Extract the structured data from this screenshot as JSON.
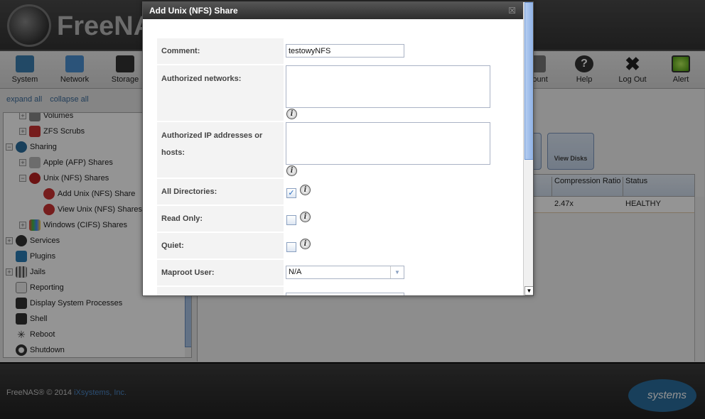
{
  "header": {
    "brand": "FreeNAS"
  },
  "toolbar": {
    "items": [
      {
        "label": "System",
        "icon": "system-icon"
      },
      {
        "label": "Network",
        "icon": "network-icon"
      },
      {
        "label": "Storage",
        "icon": "storage-icon"
      },
      {
        "label": "Account",
        "visible": "ount",
        "icon": "account-icon"
      },
      {
        "label": "Help",
        "icon": "help-icon"
      },
      {
        "label": "Log Out",
        "icon": "logout-icon"
      },
      {
        "label": "Alert",
        "icon": "alert-icon"
      }
    ]
  },
  "tree_links": {
    "expand": "expand all",
    "collapse": "collapse all"
  },
  "tree": [
    {
      "label": "Volumes"
    },
    {
      "label": "ZFS Scrubs"
    },
    {
      "label": "Sharing"
    },
    {
      "label": "Apple (AFP) Shares"
    },
    {
      "label": "Unix (NFS) Shares"
    },
    {
      "label": "Add Unix (NFS) Share"
    },
    {
      "label": "View Unix (NFS) Shares"
    },
    {
      "label": "Windows (CIFS) Shares"
    },
    {
      "label": "Services"
    },
    {
      "label": "Plugins"
    },
    {
      "label": "Jails"
    },
    {
      "label": "Reporting"
    },
    {
      "label": "Display System Processes"
    },
    {
      "label": "Shell"
    },
    {
      "label": "Reboot"
    },
    {
      "label": "Shutdown"
    }
  ],
  "main": {
    "view_disks": "View Disks",
    "columns": [
      "Compression Ratio",
      "Status"
    ],
    "row": [
      "2.47x",
      "HEALTHY"
    ]
  },
  "footer": {
    "copyright": "FreeNAS® © 2014",
    "company": "iXsystems, Inc.",
    "logo_text": "systems"
  },
  "dialog": {
    "title": "Add Unix (NFS) Share",
    "close": "☒",
    "fields": {
      "comment": {
        "label": "Comment:",
        "value": "testowyNFS"
      },
      "networks": {
        "label": "Authorized networks:",
        "value": ""
      },
      "hosts": {
        "label": "Authorized IP addresses or hosts:",
        "value": ""
      },
      "alldirs": {
        "label": "All Directories:",
        "checked": true
      },
      "readonly": {
        "label": "Read Only:",
        "checked": false
      },
      "quiet": {
        "label": "Quiet:",
        "checked": false
      },
      "maproot": {
        "label": "Maproot User:",
        "value": "N/A"
      }
    },
    "info_glyph": "i"
  },
  "colors": {
    "accent": "#3a6a9a",
    "dialog_title": "#2e2e2e",
    "healthy": "#222222"
  }
}
